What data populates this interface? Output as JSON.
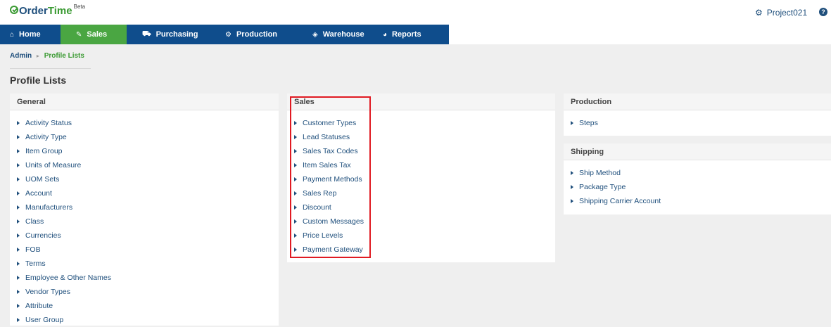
{
  "app": {
    "logo_order": "Order",
    "logo_time": "Time",
    "logo_beta": "Beta",
    "project": "Project021",
    "help_glyph": "?"
  },
  "nav": [
    {
      "label": "Home",
      "icon": "home-icon",
      "glyph": "⌂"
    },
    {
      "label": "Sales",
      "icon": "tag-icon",
      "glyph": "✎"
    },
    {
      "label": "Purchasing",
      "icon": "cart-icon",
      "glyph": "⛟"
    },
    {
      "label": "Production",
      "icon": "gears-icon",
      "glyph": "⚙"
    },
    {
      "label": "Warehouse",
      "icon": "cube-icon",
      "glyph": "◈"
    },
    {
      "label": "Reports",
      "icon": "pie-chart-icon",
      "glyph": "◕"
    }
  ],
  "breadcrumb": {
    "root": "Admin",
    "current": "Profile Lists"
  },
  "page_title": "Profile Lists",
  "panels": {
    "general": {
      "title": "General",
      "items": [
        "Activity Status",
        "Activity Type",
        "Item Group",
        "Units of Measure",
        "UOM Sets",
        "Account",
        "Manufacturers",
        "Class",
        "Currencies",
        "FOB",
        "Terms",
        "Employee & Other Names",
        "Vendor Types",
        "Attribute",
        "User Group"
      ]
    },
    "sales": {
      "title": "Sales",
      "items": [
        "Customer Types",
        "Lead Statuses",
        "Sales Tax Codes",
        "Item Sales Tax",
        "Payment Methods",
        "Sales Rep",
        "Discount",
        "Custom Messages",
        "Price Levels",
        "Payment Gateway"
      ]
    },
    "production": {
      "title": "Production",
      "items": [
        "Steps"
      ]
    },
    "shipping": {
      "title": "Shipping",
      "items": [
        "Ship Method",
        "Package Type",
        "Shipping Carrier Account"
      ]
    }
  },
  "colors": {
    "nav_bg": "#0f4d8c",
    "nav_active": "#4aa642",
    "link": "#1f4f7c",
    "highlight": "#e01a22"
  }
}
